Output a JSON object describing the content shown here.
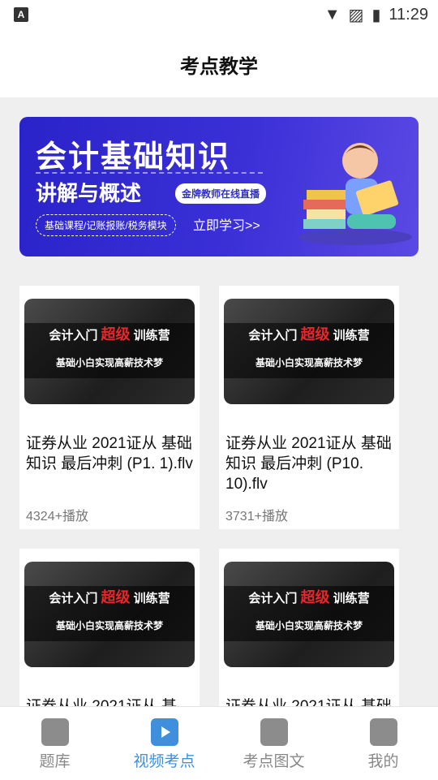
{
  "status": {
    "left_icon": "A",
    "time": "11:29"
  },
  "header": {
    "title": "考点教学"
  },
  "banner": {
    "title": "会计基础知识",
    "subtitle": "讲解与概述",
    "tag": "金牌教师在线直播",
    "categories": "基础课程/记账报账/税务模块",
    "cta": "立即学习>>"
  },
  "cards": [
    {
      "thumb_line1_a": "会计入门",
      "thumb_red": "超级",
      "thumb_line1_b": "训练营",
      "thumb_line2": "基础小白实现高薪技术梦",
      "title": "证券从业 2021证从 基础知识 最后冲刺 (P1. 1).flv",
      "plays": "4324+播放"
    },
    {
      "thumb_line1_a": "会计入门",
      "thumb_red": "超级",
      "thumb_line1_b": "训练营",
      "thumb_line2": "基础小白实现高薪技术梦",
      "title": "证券从业 2021证从 基础知识 最后冲刺 (P10. 10).flv",
      "plays": "3731+播放"
    },
    {
      "thumb_line1_a": "会计入门",
      "thumb_red": "超级",
      "thumb_line1_b": "训练营",
      "thumb_line2": "基础小白实现高薪技术梦",
      "title": "证券从业 2021证从 基",
      "plays": ""
    },
    {
      "thumb_line1_a": "会计入门",
      "thumb_red": "超级",
      "thumb_line1_b": "训练营",
      "thumb_line2": "基础小白实现高薪技术梦",
      "title": "证券从业 2021证从 基础",
      "plays": ""
    }
  ],
  "tabs": [
    {
      "label": "题库",
      "icon": "book-icon"
    },
    {
      "label": "视频考点",
      "icon": "video-icon"
    },
    {
      "label": "考点图文",
      "icon": "image-icon"
    },
    {
      "label": "我的",
      "icon": "profile-icon"
    }
  ],
  "colors": {
    "accent": "#3f8fdc",
    "banner": "#3b30d7",
    "highlight_red": "#e8262b"
  }
}
